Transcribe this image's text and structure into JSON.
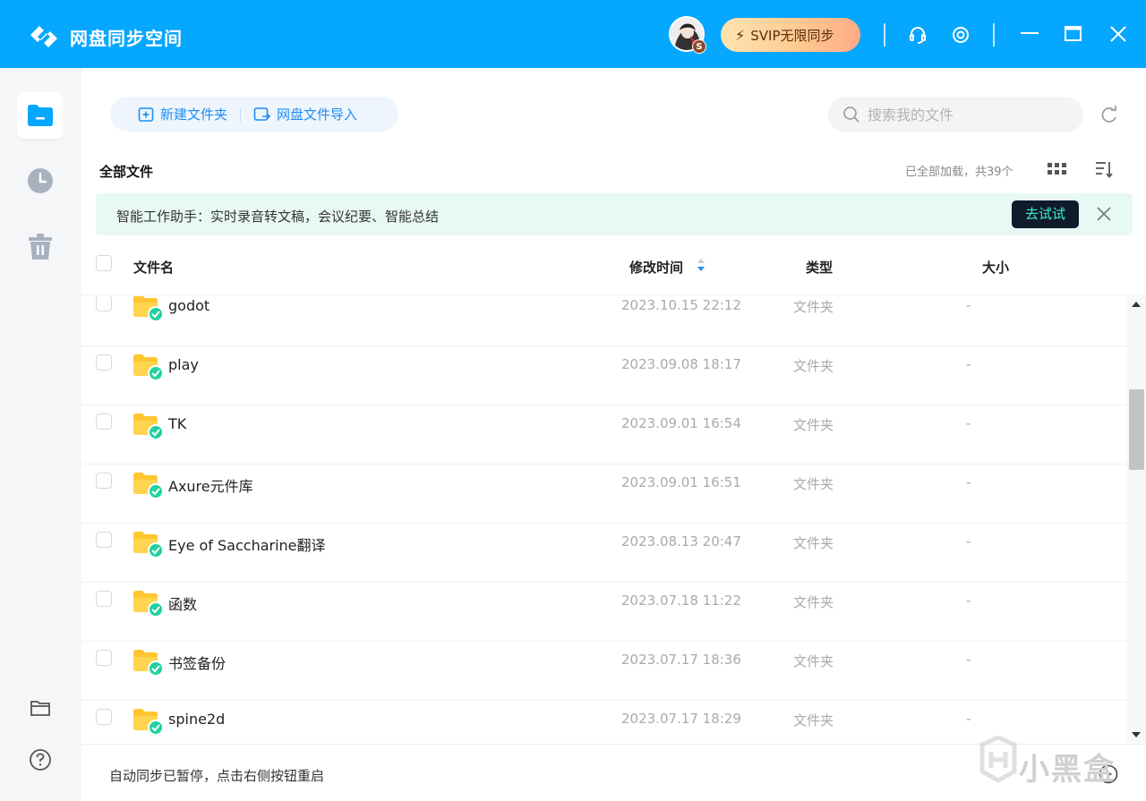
{
  "app": {
    "title": "网盘同步空间",
    "svip_label": "SVIP无限同步",
    "avatar_badge": "S"
  },
  "toolbar": {
    "new_folder": "新建文件夹",
    "import": "网盘文件导入",
    "search_placeholder": "搜索我的文件"
  },
  "breadcrumb": "全部文件",
  "load_status": "已全部加载，共39个",
  "banner": {
    "text": "智能工作助手：实时录音转文稿，会议纪要、智能总结",
    "try_label": "去试试"
  },
  "table": {
    "headers": {
      "name": "文件名",
      "modified": "修改时间",
      "type": "类型",
      "size": "大小"
    },
    "rows": [
      {
        "name": "godot",
        "modified": "2023.10.15 22:12",
        "type": "文件夹",
        "size": "-"
      },
      {
        "name": "play",
        "modified": "2023.09.08 18:17",
        "type": "文件夹",
        "size": "-"
      },
      {
        "name": "TK",
        "modified": "2023.09.01 16:54",
        "type": "文件夹",
        "size": "-"
      },
      {
        "name": "Axure元件库",
        "modified": "2023.09.01 16:51",
        "type": "文件夹",
        "size": "-"
      },
      {
        "name": "Eye of Saccharine翻译",
        "modified": "2023.08.13 20:47",
        "type": "文件夹",
        "size": "-"
      },
      {
        "name": "函数",
        "modified": "2023.07.18 11:22",
        "type": "文件夹",
        "size": "-"
      },
      {
        "name": "书签备份",
        "modified": "2023.07.17 18:36",
        "type": "文件夹",
        "size": "-"
      },
      {
        "name": "spine2d",
        "modified": "2023.07.17 18:29",
        "type": "文件夹",
        "size": "-"
      }
    ]
  },
  "footer": {
    "status": "自动同步已暂停，点击右侧按钮重启"
  },
  "watermark": "小黑盒",
  "colors": {
    "titlebar": "#06a7ff",
    "accent": "#1f8ef1",
    "folder": "#ffc631",
    "sync_check": "#21d19f",
    "banner_bg": "#e8f9f5"
  }
}
